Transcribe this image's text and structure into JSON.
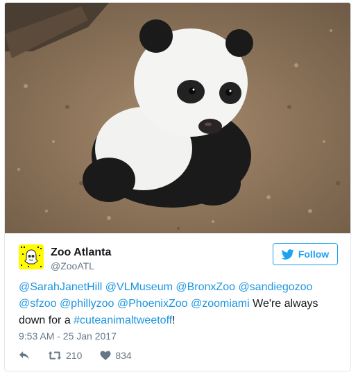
{
  "image": {
    "description_icon": "panda-photo"
  },
  "account": {
    "name": "Zoo Atlanta",
    "handle": "@ZooATL",
    "avatar_icon": "snapcode-ghost-icon"
  },
  "follow_button": {
    "label": "Follow",
    "icon": "twitter-bird-icon"
  },
  "tweet": {
    "segments": [
      {
        "text": "@SarahJanetHill",
        "link": true
      },
      {
        "text": " ",
        "link": false
      },
      {
        "text": "@VLMuseum",
        "link": true
      },
      {
        "text": " ",
        "link": false
      },
      {
        "text": "@BronxZoo",
        "link": true
      },
      {
        "text": " ",
        "link": false
      },
      {
        "text": "@sandiegozoo",
        "link": true
      },
      {
        "text": " ",
        "link": false
      },
      {
        "text": "@sfzoo",
        "link": true
      },
      {
        "text": " ",
        "link": false
      },
      {
        "text": "@phillyzoo",
        "link": true
      },
      {
        "text": " ",
        "link": false
      },
      {
        "text": "@PhoenixZoo",
        "link": true
      },
      {
        "text": " ",
        "link": false
      },
      {
        "text": "@zoomiami",
        "link": true
      },
      {
        "text": " We're always down for a ",
        "link": false
      },
      {
        "text": "#cuteanimaltweetoff",
        "link": true
      },
      {
        "text": "!",
        "link": false
      }
    ]
  },
  "timestamp": "9:53 AM - 25 Jan 2017",
  "actions": {
    "reply_icon": "reply-icon",
    "retweet_count": "210",
    "like_count": "834"
  },
  "colors": {
    "link": "#1b95e0",
    "follow": "#1da1f2",
    "muted": "#657786",
    "snapchat": "#fffc00"
  }
}
